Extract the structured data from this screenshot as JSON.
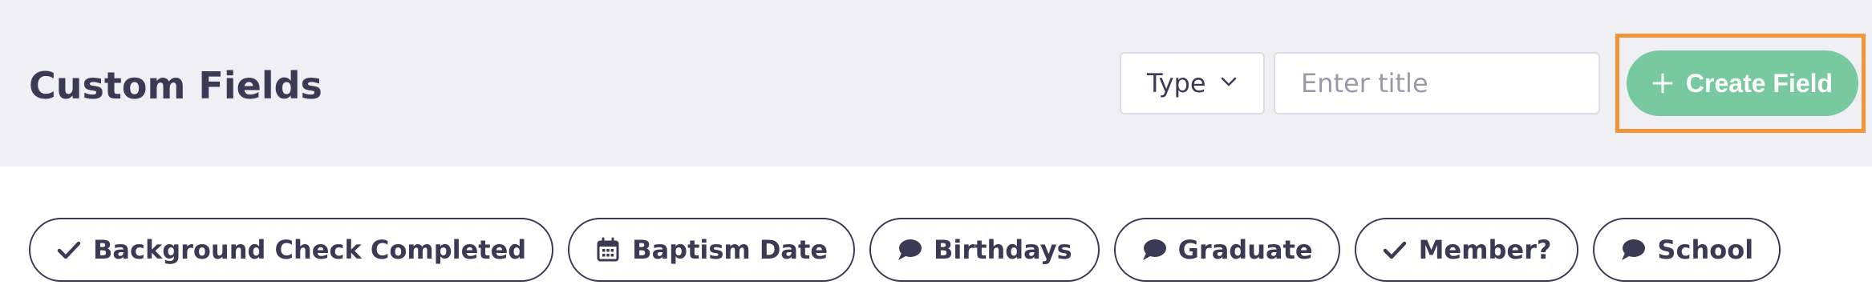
{
  "header": {
    "title": "Custom Fields",
    "type_select": {
      "label": "Type"
    },
    "title_input": {
      "placeholder": "Enter title",
      "value": ""
    },
    "create_button": {
      "label": "Create Field",
      "icon": "plus-icon"
    }
  },
  "fields": [
    {
      "label": "Background Check Completed",
      "icon": "check-icon"
    },
    {
      "label": "Baptism Date",
      "icon": "calendar-icon"
    },
    {
      "label": "Birthdays",
      "icon": "speech-bubble-icon"
    },
    {
      "label": "Graduate",
      "icon": "speech-bubble-icon"
    },
    {
      "label": "Member?",
      "icon": "check-icon"
    },
    {
      "label": "School",
      "icon": "speech-bubble-icon"
    }
  ],
  "colors": {
    "header_bg": "#efeff4",
    "text": "#3b3a55",
    "accent_green": "#79c9a0",
    "highlight_orange": "#f0963a"
  }
}
